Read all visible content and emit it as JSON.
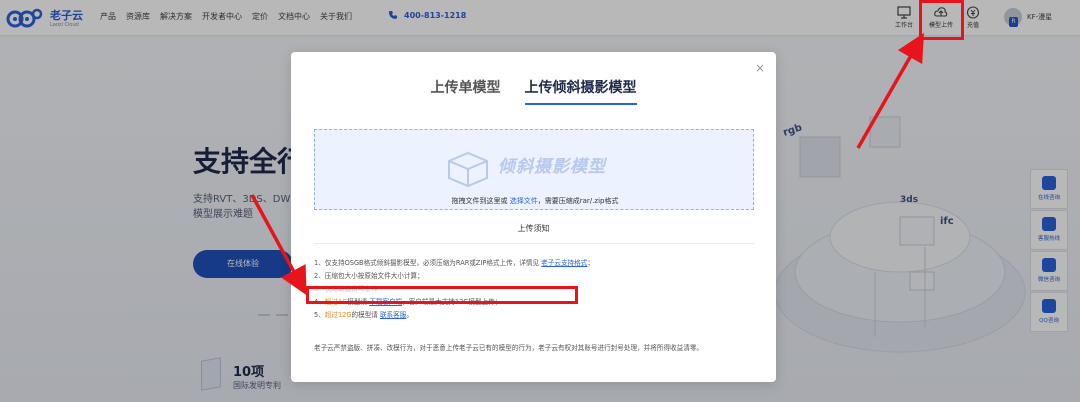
{
  "header": {
    "logo_name": "老子云",
    "logo_sub": "Laozi Cloud",
    "nav": [
      "产品",
      "资源库",
      "解决方案",
      "开发者中心",
      "定价",
      "文档中心",
      "关于我们"
    ],
    "phone": "400-813-1218",
    "tools": [
      {
        "label": "工作台",
        "icon": "monitor-icon"
      },
      {
        "label": "模型上传",
        "icon": "upload-cloud-icon"
      },
      {
        "label": "充值",
        "icon": "recharge-icon"
      }
    ],
    "user_name": "KF-漫星",
    "avatar_badge": "R"
  },
  "hero": {
    "title": "支持全行",
    "desc_line1": "支持RVT、3DS、DW",
    "desc_line2": "模型展示难题",
    "button": "在线体验",
    "stat_num": "10项",
    "stat_label": "国际发明专利"
  },
  "float_bar": [
    "在线咨询",
    "客服热线",
    "微信咨询",
    "QQ咨询"
  ],
  "illustration_labels": [
    "rgb",
    "3ds",
    "ifc"
  ],
  "modal": {
    "close": "×",
    "tabs": [
      "上传单模型",
      "上传倾斜摄影模型"
    ],
    "active_tab": 1,
    "dropzone": {
      "watermark": "倾斜摄影模型",
      "hint_before": "拖拽文件到这里或 ",
      "hint_link": "选择文件",
      "hint_after": "，需要压缩成rar/.zip格式"
    },
    "notice_title": "上传须知",
    "rules": {
      "r1_text": "1、仅支持OSGB格式倾斜摄影模型，必须压缩为RAR或ZIP格式上传，详情见 ",
      "r1_link": "老子云支持格式",
      "r1_end": "；",
      "r2_text": "2、压缩包大小按原始文件大小计算；",
      "r3_text": "3、仅超能会员可上传",
      "r4_prefix": "4、",
      "r4_orange": "超过1G",
      "r4_mid": "模型请 ",
      "r4_link": "下载客户端",
      "r4_end": "，客户端最大支持12G模型上传；",
      "r5_prefix": "5、",
      "r5_orange": "超过12G",
      "r5_mid": "的模型请 ",
      "r5_link": "联系客服",
      "r5_end": "。"
    },
    "footer_note": "老子云严禁盗版、拼凑、改模行为，对于恶意上传老子云已有的模型的行为，老子云有权对其账号进行封号处理，并将所得收益清零。"
  },
  "colors": {
    "brand": "#2a62d8",
    "highlight": "#e8141c",
    "orange": "#f08a24"
  }
}
